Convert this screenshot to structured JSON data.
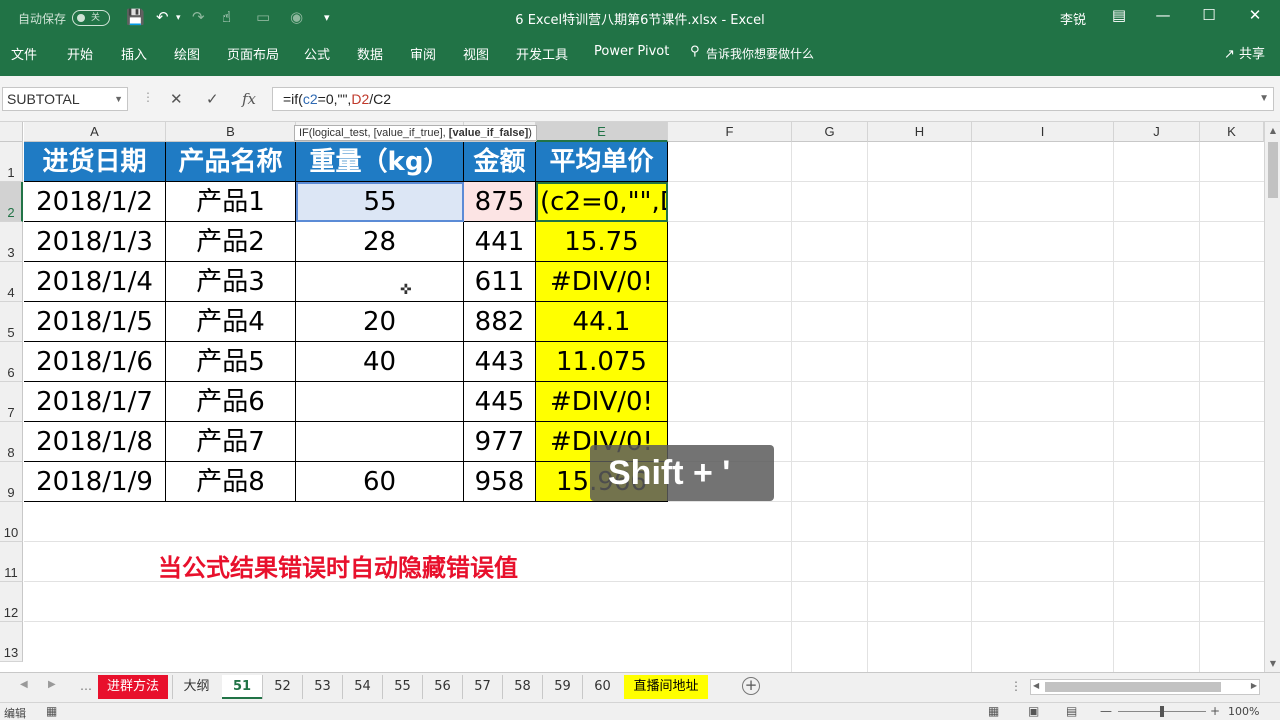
{
  "titlebar": {
    "autosave_label": "自动保存",
    "autosave_state": "关",
    "doc_title": "6 Excel特训营八期第6节课件.xlsx  -  Excel",
    "user": "李锐"
  },
  "ribbon": {
    "tabs": [
      "文件",
      "开始",
      "插入",
      "绘图",
      "页面布局",
      "公式",
      "数据",
      "审阅",
      "视图",
      "开发工具",
      "Power Pivot",
      "告诉我你想要做什么"
    ],
    "share": "共享"
  },
  "formula_bar": {
    "name_box": "SUBTOTAL",
    "formula_prefix": "=if(",
    "formula_ref1": "c2",
    "formula_mid": "=0,\"\",",
    "formula_ref2": "D2",
    "formula_tail": "/C2"
  },
  "tooltip": {
    "text": "IF(logical_test, [value_if_true], ",
    "bold": "[value_if_false]",
    "close": ")"
  },
  "columns": [
    "A",
    "B",
    "C",
    "D",
    "E",
    "F",
    "G",
    "H",
    "I",
    "J",
    "K"
  ],
  "rows": [
    "1",
    "2",
    "3",
    "4",
    "5",
    "6",
    "7",
    "8",
    "9",
    "10",
    "11",
    "12",
    "13"
  ],
  "table": {
    "headers": [
      "进货日期",
      "产品名称",
      "重量（kg）",
      "金额",
      "平均单价"
    ],
    "rows": [
      [
        "2018/1/2",
        "产品1",
        "55",
        "875",
        "(c2=0,\"\",D"
      ],
      [
        "2018/1/3",
        "产品2",
        "28",
        "441",
        "15.75"
      ],
      [
        "2018/1/4",
        "产品3",
        "",
        "611",
        "#DIV/0!"
      ],
      [
        "2018/1/5",
        "产品4",
        "20",
        "882",
        "44.1"
      ],
      [
        "2018/1/6",
        "产品5",
        "40",
        "443",
        "11.075"
      ],
      [
        "2018/1/7",
        "产品6",
        "",
        "445",
        "#DIV/0!"
      ],
      [
        "2018/1/8",
        "产品7",
        "",
        "977",
        "#DIV/0!"
      ],
      [
        "2018/1/9",
        "产品8",
        "60",
        "958",
        "15.966"
      ]
    ]
  },
  "annotation": "当公式结果错误时自动隐藏错误值",
  "key_badge": "Shift + '",
  "sheets": [
    {
      "label": "进群方法",
      "style": "red"
    },
    {
      "label": "大纲",
      "style": "plain"
    },
    {
      "label": "51",
      "style": "active"
    },
    {
      "label": "52",
      "style": "plain"
    },
    {
      "label": "53",
      "style": "plain"
    },
    {
      "label": "54",
      "style": "plain"
    },
    {
      "label": "55",
      "style": "plain"
    },
    {
      "label": "56",
      "style": "plain"
    },
    {
      "label": "57",
      "style": "plain"
    },
    {
      "label": "58",
      "style": "plain"
    },
    {
      "label": "59",
      "style": "plain"
    },
    {
      "label": "60",
      "style": "plain"
    },
    {
      "label": "直播间地址",
      "style": "yellow"
    }
  ],
  "status": {
    "mode": "编辑",
    "zoom": "100%"
  }
}
